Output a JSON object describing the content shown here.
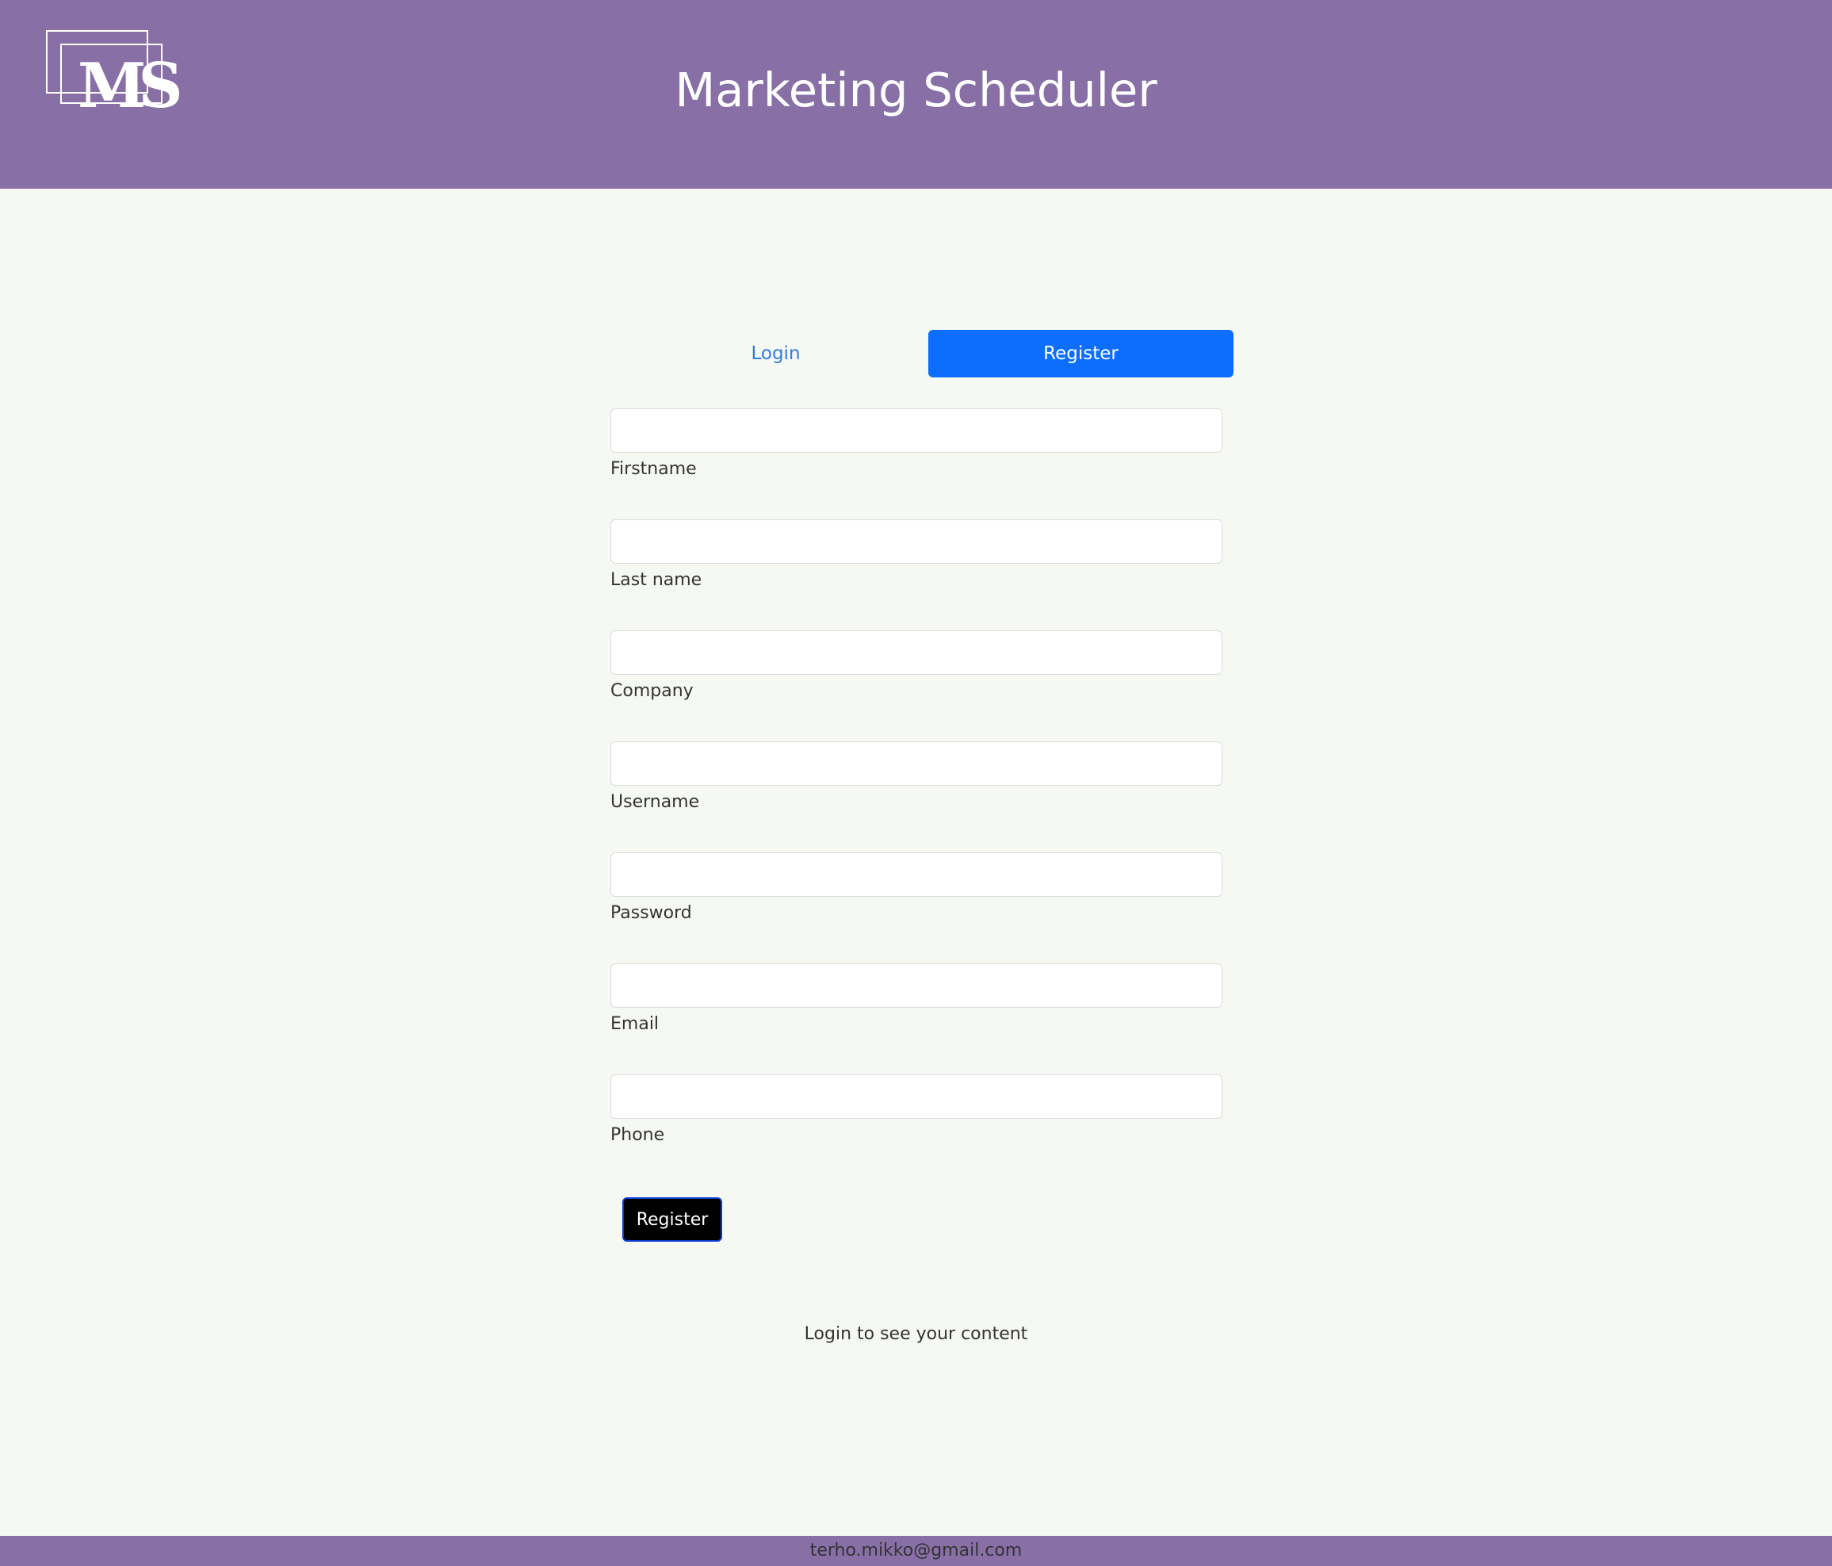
{
  "header": {
    "logo_text": "MS",
    "title": "Marketing Scheduler"
  },
  "tabs": [
    {
      "label": "Login",
      "active": false
    },
    {
      "label": "Register",
      "active": true
    }
  ],
  "form": {
    "fields": [
      {
        "label": "Firstname",
        "value": ""
      },
      {
        "label": "Last name",
        "value": ""
      },
      {
        "label": "Company",
        "value": ""
      },
      {
        "label": "Username",
        "value": ""
      },
      {
        "label": "Password",
        "value": ""
      },
      {
        "label": "Email",
        "value": ""
      },
      {
        "label": "Phone",
        "value": ""
      }
    ],
    "submit_label": "Register"
  },
  "info_text": "Login to see your content",
  "footer": {
    "email": "terho.mikko@gmail.com"
  },
  "colors": {
    "header_bg": "#8870a7",
    "page_bg": "#f6f8f3",
    "accent": "#0d6efd",
    "submit_bg": "#000000"
  }
}
